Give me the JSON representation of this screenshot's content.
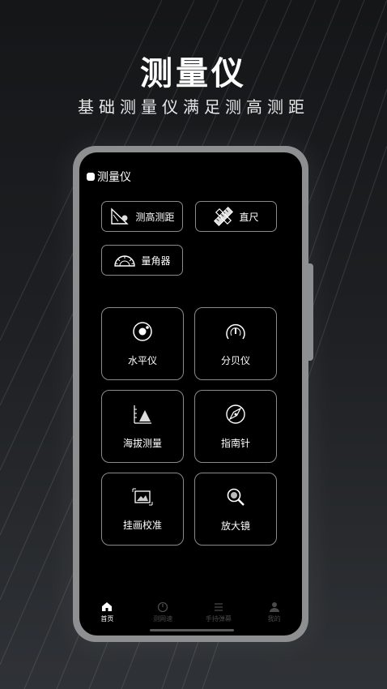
{
  "promo": {
    "title": "测量仪",
    "subtitle": "基础测量仪满足测高测距"
  },
  "app": {
    "header_title": "测量仪",
    "tools": [
      {
        "label": "测高测距",
        "icon": "triangle-ruler-icon"
      },
      {
        "label": "直尺",
        "icon": "ruler-icon"
      },
      {
        "label": "量角器",
        "icon": "protractor-icon"
      }
    ],
    "cards": [
      {
        "label": "水平仪",
        "icon": "level-icon"
      },
      {
        "label": "分贝仪",
        "icon": "gauge-icon"
      },
      {
        "label": "海拔测量",
        "icon": "mountain-icon"
      },
      {
        "label": "指南针",
        "icon": "compass-icon"
      },
      {
        "label": "挂画校准",
        "icon": "picture-frame-icon"
      },
      {
        "label": "放大镜",
        "icon": "magnifier-icon"
      }
    ],
    "tabbar": [
      {
        "label": "首页",
        "icon": "home-icon",
        "active": true
      },
      {
        "label": "测网速",
        "icon": "speed-icon",
        "active": false
      },
      {
        "label": "手持弹幕",
        "icon": "list-icon",
        "active": false
      },
      {
        "label": "我的",
        "icon": "profile-icon",
        "active": false
      }
    ]
  }
}
